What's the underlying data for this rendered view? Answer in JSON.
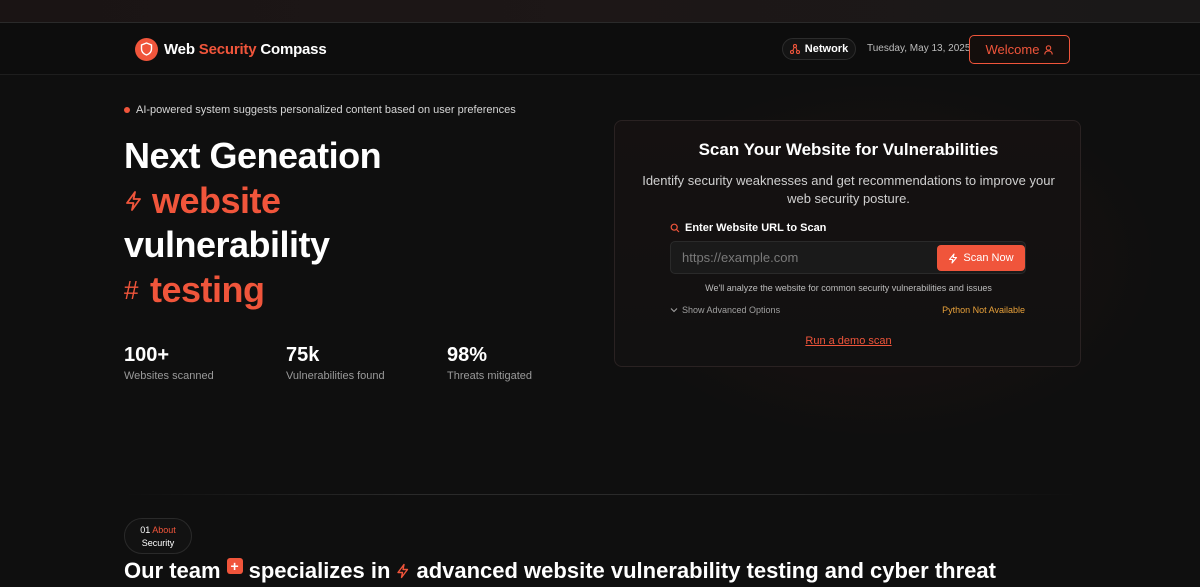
{
  "navbar": {
    "brand_part1": "Web",
    "brand_accent": "Security",
    "brand_part2": "Compass",
    "network_label": "Network",
    "date": "Tuesday, May 13, 2025",
    "welcome_label": "Welcome"
  },
  "hero": {
    "ai_tag": "AI-powered system suggests personalized content based on user preferences",
    "line1": "Next Geneation",
    "line2": "website",
    "line3": "vulnerability",
    "line4": "testing",
    "hash": "#"
  },
  "stats": [
    {
      "value": "100+",
      "label": "Websites scanned"
    },
    {
      "value": "75k",
      "label": "Vulnerabilities found"
    },
    {
      "value": "98%",
      "label": "Threats mitigated"
    }
  ],
  "scan": {
    "title": "Scan Your Website for Vulnerabilities",
    "description": "Identify security weaknesses and get recommendations to improve your web security posture.",
    "url_label": "Enter Website URL to Scan",
    "url_placeholder": "https://example.com",
    "scan_button": "Scan Now",
    "analyze_note": "We'll analyze the website for common security vulnerabilities and issues",
    "advanced_options": "Show Advanced Options",
    "python_status": "Python Not Available",
    "demo_link": "Run a demo scan"
  },
  "about": {
    "number": "01",
    "label": "About",
    "sublabel": "Security",
    "team_part1": "Our team",
    "team_part2": "specializes in",
    "team_part3": "advanced website vulnerability testing and cyber threat"
  },
  "colors": {
    "accent": "#f0553b",
    "warning": "#e8a13a",
    "background": "#0f0f0f"
  },
  "icons": [
    "shield-icon",
    "network-icon",
    "user-icon",
    "lightning-icon",
    "search-icon",
    "chevron-down-icon",
    "plus-icon"
  ]
}
